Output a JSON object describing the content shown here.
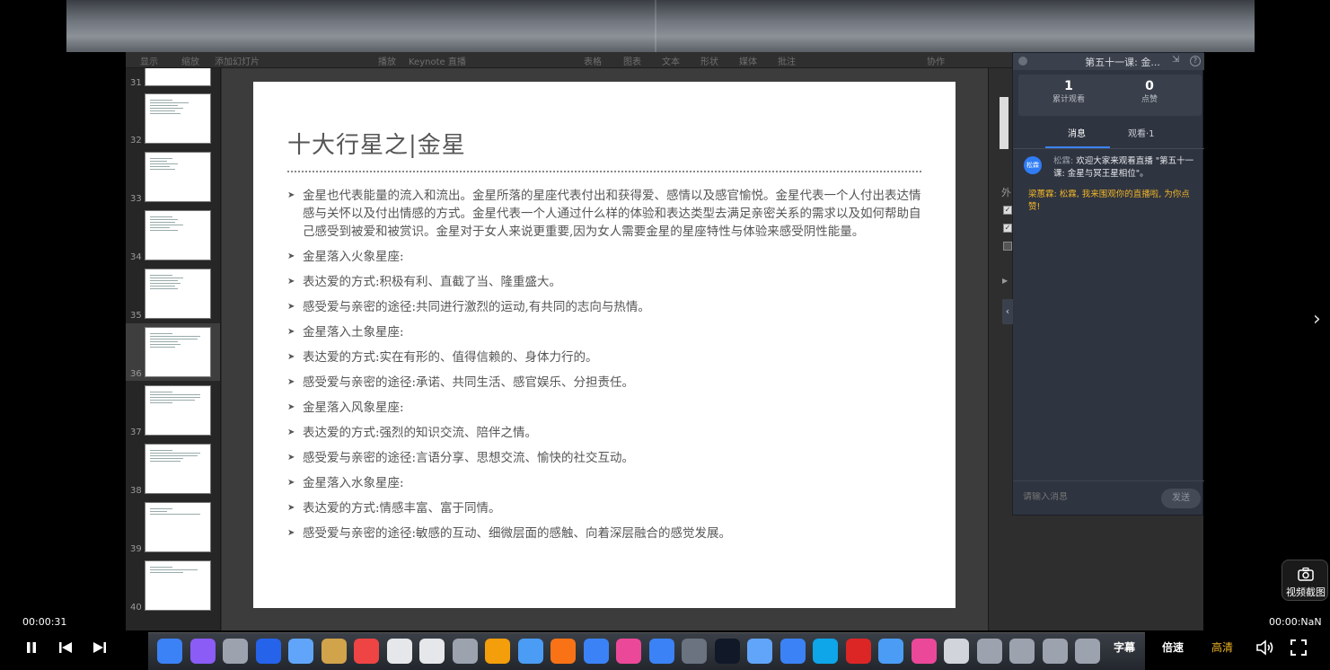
{
  "keynote": {
    "toolbar": [
      "显示",
      "缩放",
      "添加幻灯片",
      "播放",
      "Keynote 直播",
      "表格",
      "图表",
      "文本",
      "形状",
      "媒体",
      "批注",
      "协作"
    ],
    "thumbnails": [
      {
        "num": "31"
      },
      {
        "num": "32"
      },
      {
        "num": "33"
      },
      {
        "num": "34"
      },
      {
        "num": "35"
      },
      {
        "num": "36",
        "selected": true
      },
      {
        "num": "37"
      },
      {
        "num": "38"
      },
      {
        "num": "39"
      },
      {
        "num": "40"
      }
    ],
    "inspector_label": "外",
    "slide": {
      "title": "十大行星之|金星",
      "bullets": [
        "金星也代表能量的流入和流出。金星所落的星座代表付出和获得爱、感情以及感官愉悦。金星代表一个人付出表达情感与关怀以及付出情感的方式。金星代表一个人通过什么样的体验和表达类型去满足亲密关系的需求以及如何帮助自己感受到被爱和被赏识。金星对于女人来说更重要,因为女人需要金星的星座特性与体验来感受阴性能量。",
        "金星落入火象星座:",
        "表达爱的方式:积极有利、直截了当、隆重盛大。",
        "感受爱与亲密的途径:共同进行激烈的运动,有共同的志向与热情。",
        "金星落入土象星座:",
        "表达爱的方式:实在有形的、值得信赖的、身体力行的。",
        "感受爱与亲密的途径:承诺、共同生活、感官娱乐、分担责任。",
        "金星落入风象星座:",
        "表达爱的方式:强烈的知识交流、陪伴之情。",
        "感受爱与亲密的途径:言语分享、思想交流、愉快的社交互动。",
        "金星落入水象星座:",
        "表达爱的方式:情感丰富、富于同情。",
        "感受爱与亲密的途径:敏感的互动、细微层面的感触、向着深层融合的感觉发展。"
      ]
    }
  },
  "live": {
    "title": "第五十一课: 金...",
    "views_count": "1",
    "views_label": "累计观看",
    "likes_count": "0",
    "likes_label": "点赞",
    "tab_messages": "消息",
    "tab_viewers": "观看·1",
    "avatar_text": "松霖",
    "msg1_author": "松霖:",
    "msg1_text": "欢迎大家来观看直播 \"第五十一课: 金星与冥王星相位\"。",
    "msg2": "梁蕙霖: 松霖, 我来围观你的直播啦, 为你点赞!",
    "input_placeholder": "请输入消息",
    "send_label": "发送"
  },
  "player": {
    "time_current": "00:00:31",
    "time_total": "00:00:NaN",
    "subtitle_label": "字幕",
    "speed_label": "倍速",
    "quality_label": "高清",
    "screenshot_label": "视频截图"
  },
  "dock_icon_colors": [
    "#3b82f6",
    "#8b5cf6",
    "#9ca3af",
    "#2563eb",
    "#60a5fa",
    "#d1a34a",
    "#ef4444",
    "#e5e7eb",
    "#e5e7eb",
    "#9ca3af",
    "#f59e0b",
    "#4b9cf5",
    "#f97316",
    "#3b82f6",
    "#ec4899",
    "#3b82f6",
    "#6b7280",
    "#111827",
    "#60a5fa",
    "#3b82f6",
    "#0ea5e9",
    "#dc2626",
    "#4b9cf5",
    "#ec4899",
    "#d1d5db",
    "#9ca3af",
    "#9ca3af",
    "#9ca3af",
    "#9ca3af"
  ]
}
